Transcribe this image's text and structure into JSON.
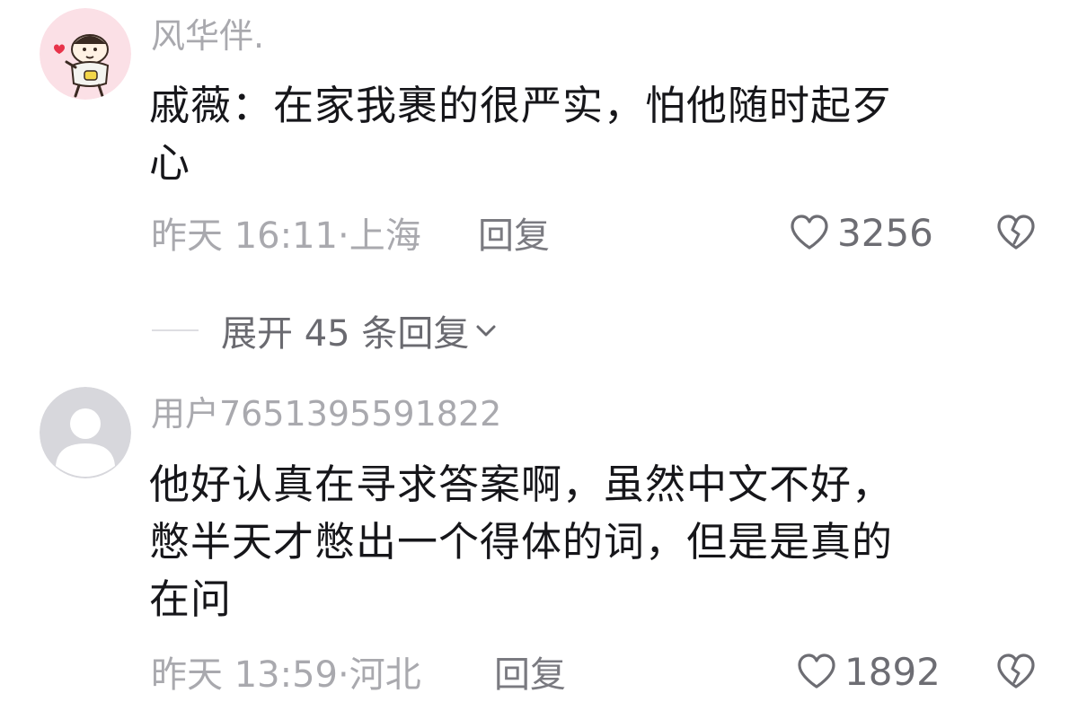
{
  "comments": [
    {
      "username": "风华伴.",
      "content_lines": [
        "戚薇：在家我裹的很严实，怕他随时起歹",
        "心"
      ],
      "time": "昨天 16:11·上海",
      "reply_label": "回复",
      "likes": "3256",
      "avatar": "cartoon-character-avatar",
      "expand_replies": "展开 45 条回复"
    },
    {
      "username": "用户7651395591822",
      "content_lines": [
        "他好认真在寻求答案啊，虽然中文不好，",
        "憋半天才憋出一个得体的词，但是是真的",
        "在问"
      ],
      "time": "昨天 13:59·河北",
      "reply_label": "回复",
      "likes": "1892",
      "avatar": "default-user-avatar"
    }
  ],
  "colors": {
    "meta_gray": "#a9a9ae",
    "text_dark": "#16161a",
    "avatar_pink_bg": "#fbe0e6",
    "avatar_gray_bg": "#d7d7dc"
  }
}
